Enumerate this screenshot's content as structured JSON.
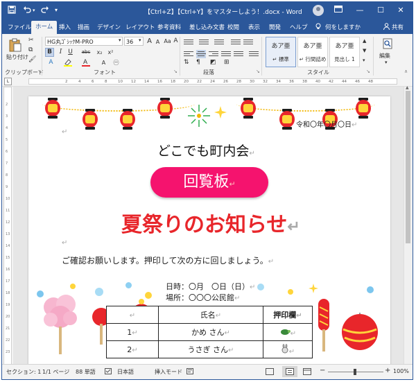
{
  "window": {
    "title": "【Ctrl+Z】【Ctrl+Y】をマスターしよう！.docx - Word",
    "controls": [
      "ribbon-display",
      "minimize",
      "maximize",
      "close"
    ]
  },
  "quick_access": {
    "save": "save-icon",
    "undo": "undo-icon",
    "redo": "redo-icon",
    "customize": "▾"
  },
  "tabs": [
    "ファイル",
    "ホーム",
    "挿入",
    "描画",
    "デザイン",
    "レイアウト",
    "参考資料",
    "差し込み文書",
    "校閲",
    "表示",
    "開発",
    "ヘルプ"
  ],
  "active_tab": "ホーム",
  "tell_me": "何をしますか",
  "share": "共有",
  "ribbon": {
    "clipboard": {
      "paste": "貼り付け",
      "label": "クリップボード"
    },
    "font": {
      "name": "HG丸ｺﾞｼｯｸM-PRO",
      "size": "36",
      "grow": "A",
      "shrink": "A",
      "case": "Aa",
      "clear": "A",
      "format_buttons": [
        "B",
        "I",
        "U",
        "abc",
        "x₂",
        "x²"
      ],
      "label": "フォント"
    },
    "paragraph": {
      "label": "段落"
    },
    "styles": {
      "items": [
        {
          "sample": "あア亜",
          "name": "↵ 標準"
        },
        {
          "sample": "あア亜",
          "name": "↵ 行間詰め"
        },
        {
          "sample": "あア亜",
          "name": "見出し 1"
        }
      ],
      "label": "スタイル"
    },
    "editing": {
      "label": "編集"
    }
  },
  "ruler": {
    "ticks": [
      "2",
      "4",
      "6",
      "8",
      "10",
      "12",
      "14",
      "16",
      "18",
      "20",
      "22",
      "24",
      "26",
      "28",
      "30",
      "32",
      "34",
      "36",
      "38",
      "40",
      "42",
      "44",
      "46",
      "48"
    ],
    "vticks": [
      "2",
      "3",
      "4",
      "5",
      "6",
      "7",
      "8",
      "9",
      "10",
      "11",
      "12",
      "13",
      "14",
      "15",
      "16",
      "17",
      "18",
      "19",
      "20",
      "21",
      "22",
      "23"
    ]
  },
  "document": {
    "date": "令和〇年〇月〇日",
    "org": "どこでも町内会",
    "badge": "回覧板",
    "headline": "夏祭りのお知らせ",
    "body": "ご確認お願いします。押印して次の方に回しましょう。",
    "when": "日時：〇月　〇日（日）",
    "where": "場所：〇〇〇公民館",
    "table": {
      "headers": [
        "",
        "氏名",
        "押印欄"
      ],
      "rows": [
        {
          "no": "1",
          "name": "かめ さん",
          "stamp": "turtle-stamp-icon"
        },
        {
          "no": "2",
          "name": "うさぎ さん",
          "stamp": "rabbit-stamp-icon"
        }
      ]
    },
    "return_mark": "↵"
  },
  "status": {
    "section": "セクション: 1",
    "page": "1/1 ページ",
    "words": "88 単語",
    "language": "日本語",
    "mode": "挿入モード",
    "zoom": "100%"
  },
  "colors": {
    "word_blue": "#2b579a",
    "headline_red": "#e8262b",
    "badge_pink": "#f5136e",
    "lantern_red": "#e8262b",
    "lantern_yellow": "#ffd53b"
  }
}
